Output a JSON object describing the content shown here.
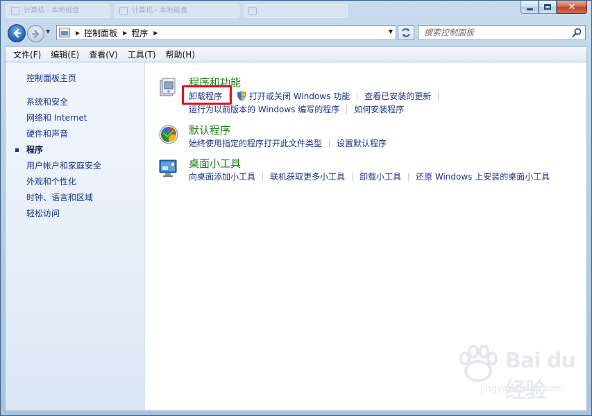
{
  "window": {
    "ghost_tabs": [
      "计算机 - 本地磁盘",
      "计算机 - 本地磁盘"
    ]
  },
  "navigation": {
    "breadcrumbs": [
      "控制面板",
      "程序"
    ],
    "search_placeholder": "搜索控制面板"
  },
  "menu": {
    "items": [
      "文件(F)",
      "编辑(E)",
      "查看(V)",
      "工具(T)",
      "帮助(H)"
    ]
  },
  "sidebar": {
    "home": "控制面板主页",
    "items": [
      {
        "label": "系统和安全",
        "current": false
      },
      {
        "label": "网络和 Internet",
        "current": false
      },
      {
        "label": "硬件和声音",
        "current": false
      },
      {
        "label": "程序",
        "current": true
      },
      {
        "label": "用户帐户和家庭安全",
        "current": false
      },
      {
        "label": "外观和个性化",
        "current": false
      },
      {
        "label": "时钟、语言和区域",
        "current": false
      },
      {
        "label": "轻松访问",
        "current": false
      }
    ]
  },
  "categories": [
    {
      "title": "程序和功能",
      "icon": "programs-features-icon",
      "tasks_row1": [
        "卸载程序",
        "打开或关闭 Windows 功能",
        "查看已安装的更新"
      ],
      "tasks_row2": [
        "运行为以前版本的 Windows 编写的程序",
        "如何安装程序"
      ]
    },
    {
      "title": "默认程序",
      "icon": "default-programs-icon",
      "tasks_row1": [
        "始终使用指定的程序打开此文件类型",
        "设置默认程序"
      ]
    },
    {
      "title": "桌面小工具",
      "icon": "desktop-gadgets-icon",
      "tasks_row1": [
        "向桌面添加小工具",
        "联机获取更多小工具",
        "卸载小工具",
        "还原 Windows 上安装的桌面小工具"
      ]
    }
  ],
  "watermark": {
    "brand": "Bai du 经验",
    "url": "jingyan.baidu.com"
  },
  "colors": {
    "link": "#1e3287",
    "category_title": "#1e7a15",
    "highlight": "#e3101a"
  }
}
